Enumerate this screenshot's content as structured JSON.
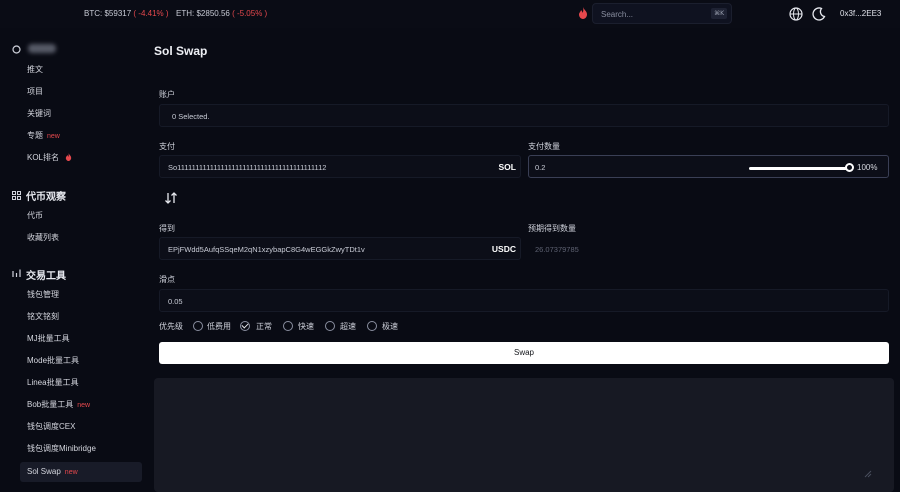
{
  "topbar": {
    "btc_label": "BTC:",
    "btc_price": "$59317",
    "btc_change": "( -4.41% )",
    "eth_label": "ETH:",
    "eth_price": "$2850.56",
    "eth_change": "( -5.05% )",
    "search_placeholder": "Search...",
    "search_shortcut": "⌘K",
    "wallet_address": "0x3f...2EE3"
  },
  "sidebar": {
    "sections": [
      {
        "title": "",
        "items": [
          {
            "label": "推文"
          },
          {
            "label": "项目"
          },
          {
            "label": "关键词"
          },
          {
            "label": "专题",
            "badge": "new"
          },
          {
            "label": "KOL排名"
          }
        ]
      },
      {
        "title": "代币观察",
        "items": [
          {
            "label": "代币"
          },
          {
            "label": "收藏列表"
          }
        ]
      },
      {
        "title": "交易工具",
        "items": [
          {
            "label": "钱包管理"
          },
          {
            "label": "铭文铭刻"
          },
          {
            "label": "MJ批量工具"
          },
          {
            "label": "Mode批量工具"
          },
          {
            "label": "Linea批量工具"
          },
          {
            "label": "Bob批量工具",
            "badge": "new"
          },
          {
            "label": "钱包调度CEX"
          },
          {
            "label": "钱包调度Minibridge"
          },
          {
            "label": "Sol Swap",
            "badge": "new"
          }
        ]
      }
    ]
  },
  "main": {
    "title": "Sol Swap",
    "account_label": "账户",
    "account_value": "0 Selected.",
    "pay_label": "支付",
    "pay_address": "So11111111111111111111111111111111111111112",
    "pay_token": "SOL",
    "pay_amount_label": "支付数量",
    "pay_amount": "0.2",
    "pay_percent": "100%",
    "pay_percent_value": 100,
    "receive_label": "得到",
    "receive_address": "EPjFWdd5AufqSSqeM2qN1xzybapC8G4wEGGkZwyTDt1v",
    "receive_token": "USDC",
    "expected_label": "预期得到数量",
    "expected_amount": "26.07379785",
    "slippage_label": "滑点",
    "slippage_value": "0.05",
    "priority_label": "优先级",
    "priority_options": [
      "低费用",
      "正常",
      "快速",
      "超速",
      "极速"
    ],
    "priority_selected": "正常",
    "swap_button": "Swap"
  },
  "colors": {
    "background": "#090b14",
    "negative": "#e5484d",
    "button": "#ffffff",
    "active_nav": "#181b28"
  }
}
